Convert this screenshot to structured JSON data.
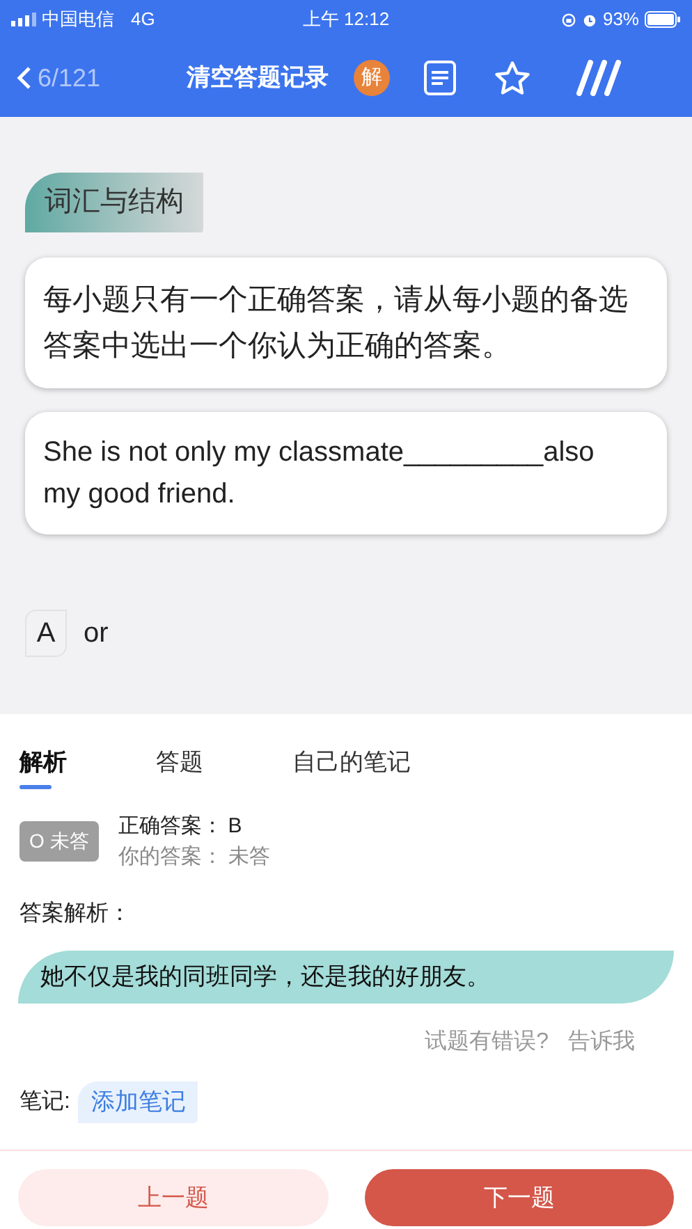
{
  "status_bar": {
    "carrier": "中国电信",
    "network": "4G",
    "time": "上午 12:12",
    "battery": "93%"
  },
  "nav": {
    "counter": "6/121",
    "title": "清空答题记录",
    "badge": "解"
  },
  "section_tag": "词汇与结构",
  "instruction": "每小题只有一个正确答案，请从每小题的备选答案中选出一个你认为正确的答案。",
  "question": "She is not only my classmate_________also my good friend.",
  "options": [
    {
      "letter": "A",
      "text": "or"
    }
  ],
  "tabs": [
    {
      "label": "解析",
      "selected": true
    },
    {
      "label": "答题",
      "selected": false
    },
    {
      "label": "自己的笔记",
      "selected": false
    }
  ],
  "answer": {
    "status": "O 未答",
    "correct_label": "正确答案：",
    "correct": "B",
    "yours_label": "你的答案：",
    "yours": "未答"
  },
  "analysis_label": "答案解析：",
  "analysis": "她不仅是我的同班同学，还是我的好朋友。",
  "report": {
    "question": "试题有错误?",
    "link": "告诉我"
  },
  "notes": {
    "label": "笔记:",
    "button": "添加笔记"
  },
  "buttons": [
    {
      "label": "上一题",
      "kind": "secondary"
    },
    {
      "label": "下一题",
      "kind": "primary"
    }
  ]
}
